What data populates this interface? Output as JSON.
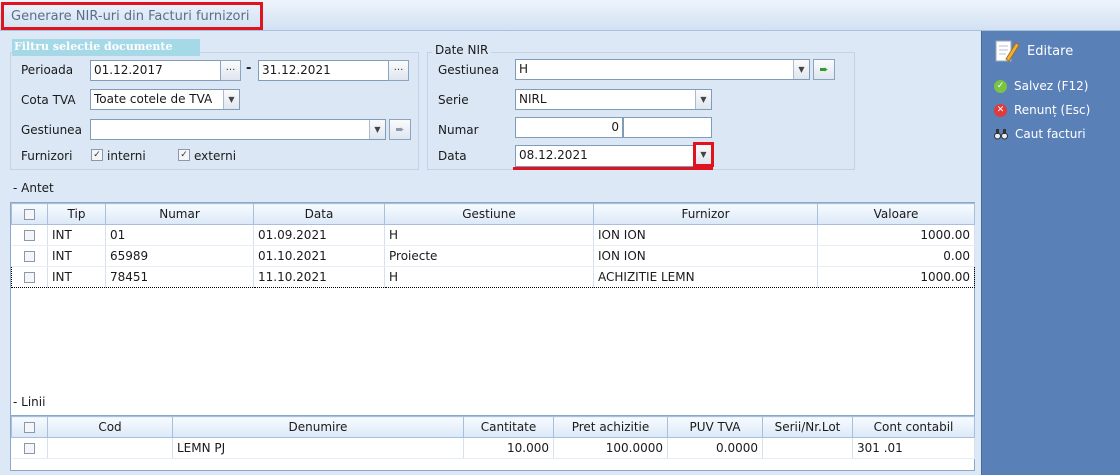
{
  "window": {
    "title": "Generare NIR-uri din Facturi furnizori"
  },
  "filter": {
    "tag": "Filtru selectie documente",
    "period_label": "Perioada",
    "date_from": "01.12.2017",
    "separator": "-",
    "date_to": "31.12.2021",
    "ellipsis": "···",
    "vat_label": "Cota TVA",
    "vat_value": "Toate cotele de TVA",
    "store_label": "Gestiunea",
    "store_value": "",
    "suppliers_label": "Furnizori",
    "internal_label": "interni",
    "external_label": "externi"
  },
  "nir": {
    "legend": "Date NIR",
    "store_label": "Gestiunea",
    "store_value": "H",
    "series_label": "Serie",
    "series_value": "NIRL",
    "number_label": "Numar",
    "number_value": "0",
    "number_suffix": "",
    "date_label": "Data",
    "date_value": "08.12.2021"
  },
  "antet": {
    "label": "- Antet",
    "columns": [
      "Tip",
      "Numar",
      "Data",
      "Gestiune",
      "Furnizor",
      "Valoare"
    ],
    "rows": [
      {
        "tip": "INT",
        "numar": "01",
        "data": "01.09.2021",
        "gestiune": "H",
        "furnizor": "ION ION",
        "valoare": "1000.00"
      },
      {
        "tip": "INT",
        "numar": "65989",
        "data": "01.10.2021",
        "gestiune": "Proiecte",
        "furnizor": "ION ION",
        "valoare": "0.00"
      },
      {
        "tip": "INT",
        "numar": "78451",
        "data": "11.10.2021",
        "gestiune": "H",
        "furnizor": "ACHIZITIE LEMN",
        "valoare": "1000.00"
      }
    ]
  },
  "linii": {
    "label": "- Linii",
    "columns": [
      "Cod",
      "Denumire",
      "Cantitate",
      "Pret achizitie",
      "PUV TVA",
      "Serii/Nr.Lot",
      "Cont contabil"
    ],
    "rows": [
      {
        "cod": "",
        "denumire": "LEMN PJ",
        "cantitate": "10.000",
        "pret": "100.0000",
        "puv": "0.0000",
        "serii": "",
        "cont": "301 .01"
      }
    ]
  },
  "sidebar": {
    "edit_label": "Editare",
    "save_label": "Salvez (F12)",
    "cancel_label": "Renunț (Esc)",
    "search_label": "Caut facturi"
  }
}
